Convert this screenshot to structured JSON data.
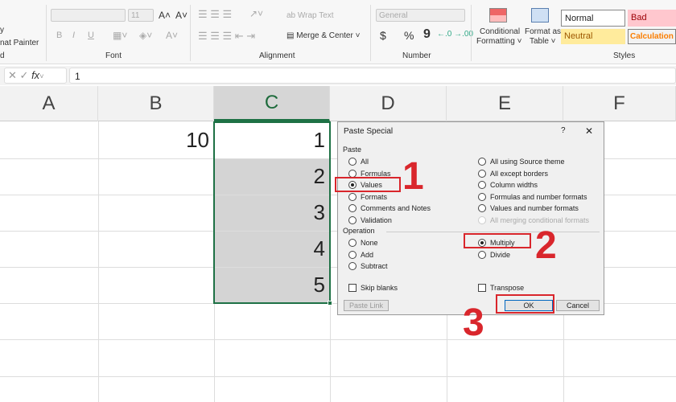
{
  "ribbon": {
    "clipboard": {
      "copy_label": "y",
      "format_painter": "nat Painter",
      "group": "d"
    },
    "font": {
      "font_size": "11",
      "group": "Font",
      "bold": "B",
      "italic": "I",
      "underline": "U"
    },
    "alignment": {
      "wrap_text": "Wrap Text",
      "merge_center": "Merge & Center",
      "group": "Alignment"
    },
    "number": {
      "format": "General",
      "currency": "$",
      "percent": "%",
      "comma": "9",
      "group": "Number"
    },
    "styles": {
      "conditional": "Conditional",
      "conditional2": "Formatting",
      "format_table": "Format as",
      "format_table2": "Table",
      "normal": "Normal",
      "bad": "Bad",
      "neutral": "Neutral",
      "calculation": "Calculation",
      "group": "Styles"
    }
  },
  "formula_bar": {
    "fx": "fx",
    "value": "1"
  },
  "columns": [
    "A",
    "B",
    "C",
    "D",
    "E",
    "F"
  ],
  "cells": {
    "B1": "10",
    "C1": "1",
    "C2": "2",
    "C3": "3",
    "C4": "4",
    "C5": "5"
  },
  "dialog": {
    "title": "Paste Special",
    "help": "?",
    "close": "✕",
    "paste_label": "Paste",
    "paste_left": [
      {
        "label": "All",
        "on": false
      },
      {
        "label": "Formulas",
        "on": false
      },
      {
        "label": "Values",
        "on": true
      },
      {
        "label": "Formats",
        "on": false
      },
      {
        "label": "Comments and Notes",
        "on": false
      },
      {
        "label": "Validation",
        "on": false
      }
    ],
    "paste_right": [
      {
        "label": "All using Source theme"
      },
      {
        "label": "All except borders"
      },
      {
        "label": "Column widths"
      },
      {
        "label": "Formulas and number formats"
      },
      {
        "label": "Values and number formats"
      },
      {
        "label": "All merging conditional formats",
        "disabled": true
      }
    ],
    "operation_label": "Operation",
    "op_left": [
      {
        "label": "None"
      },
      {
        "label": "Add"
      },
      {
        "label": "Subtract"
      }
    ],
    "op_right": [
      {
        "label": "Multiply",
        "on": true
      },
      {
        "label": "Divide"
      }
    ],
    "skip_blanks": "Skip blanks",
    "transpose": "Transpose",
    "paste_link": "Paste Link",
    "ok": "OK",
    "cancel": "Cancel"
  },
  "annotations": [
    "1",
    "2",
    "3"
  ],
  "colors": {
    "accent": "#d9262c",
    "selection": "#1e7145"
  }
}
